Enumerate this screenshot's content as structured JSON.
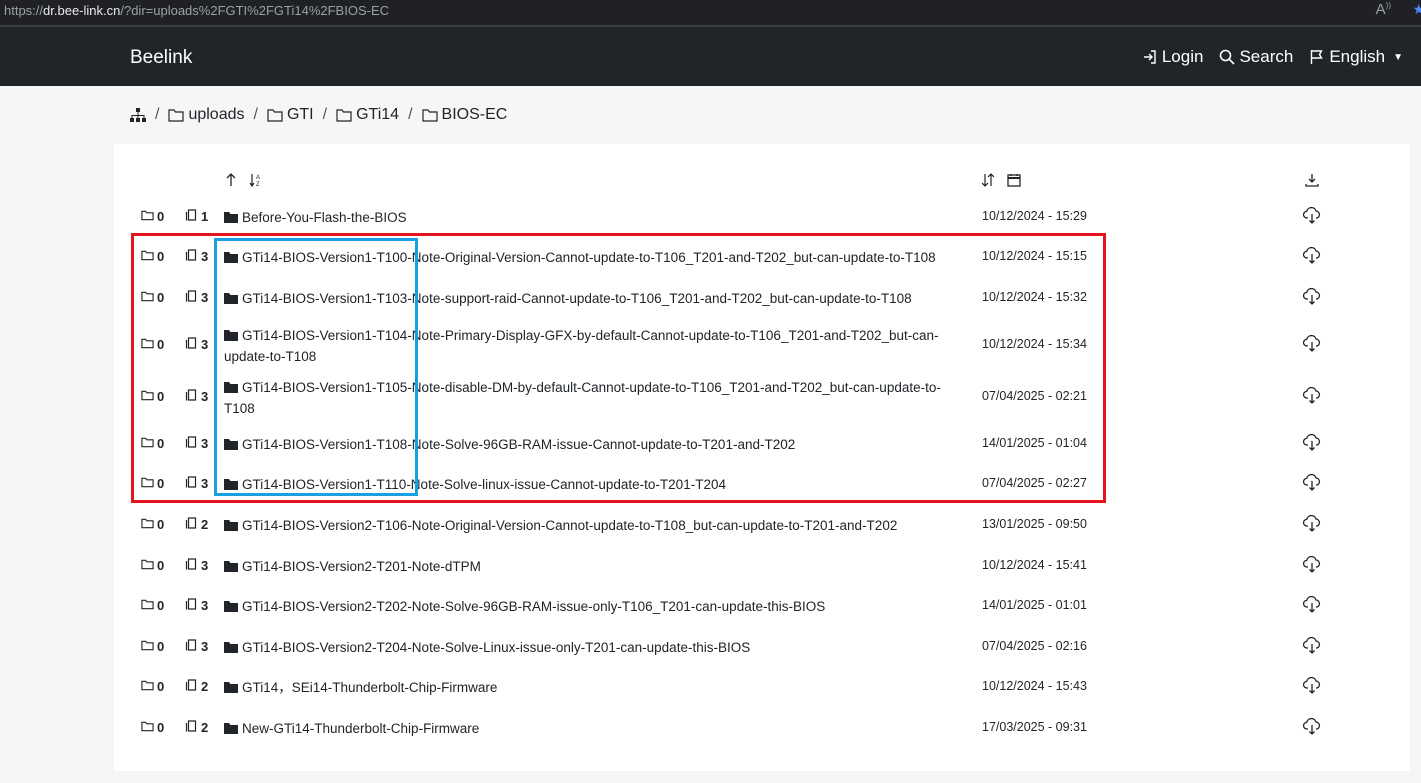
{
  "browser": {
    "url_scheme": "https://",
    "url_host": "dr.bee-link.cn",
    "url_query": "/?dir=uploads%2FGTI%2FGTi14%2FBIOS-EC",
    "read_aloud_icon": "read-aloud-icon",
    "favorite_icon": "star-icon"
  },
  "navbar": {
    "brand": "Beelink",
    "login": "Login",
    "search": "Search",
    "language": "English"
  },
  "breadcrumb": {
    "items": [
      "uploads",
      "GTI",
      "GTi14",
      "BIOS-EC"
    ],
    "separator": "/"
  },
  "colors": {
    "navbar": "#212529",
    "highlight_red": "#e5121f",
    "highlight_blue": "#1a9fe0"
  },
  "rows": [
    {
      "folders": "0",
      "files": "1",
      "name_line1": "Before-You-Flash-the-BIOS",
      "name_line2": "",
      "date": "10/12/2024 - 15:29"
    },
    {
      "folders": "0",
      "files": "3",
      "name_line1": "GTi14-BIOS-Version1-T100-Note-Original-Version-Cannot-update-to-T106_T201-and-T202_but-can-update-to-T108",
      "name_line2": "",
      "date": "10/12/2024 - 15:15"
    },
    {
      "folders": "0",
      "files": "3",
      "name_line1": "GTi14-BIOS-Version1-T103-Note-support-raid-Cannot-update-to-T106_T201-and-T202_but-can-update-to-T108",
      "name_line2": "",
      "date": "10/12/2024 - 15:32"
    },
    {
      "folders": "0",
      "files": "3",
      "name_line1": "GTi14-BIOS-Version1-T104-Note-Primary-Display-GFX-by-default-Cannot-update-to-T106_T201-and-T202_but-can-",
      "name_line2": "update-to-T108",
      "date": "10/12/2024 - 15:34"
    },
    {
      "folders": "0",
      "files": "3",
      "name_line1": "GTi14-BIOS-Version1-T105-Note-disable-DM-by-default-Cannot-update-to-T106_T201-and-T202_but-can-update-to-",
      "name_line2": "T108",
      "date": "07/04/2025 - 02:21"
    },
    {
      "folders": "0",
      "files": "3",
      "name_line1": "GTi14-BIOS-Version1-T108-Note-Solve-96GB-RAM-issue-Cannot-update-to-T201-and-T202",
      "name_line2": "",
      "date": "14/01/2025 - 01:04"
    },
    {
      "folders": "0",
      "files": "3",
      "name_line1": "GTi14-BIOS-Version1-T110-Note-Solve-linux-issue-Cannot-update-to-T201-T204",
      "name_line2": "",
      "date": "07/04/2025 - 02:27"
    },
    {
      "folders": "0",
      "files": "2",
      "name_line1": "GTi14-BIOS-Version2-T106-Note-Original-Version-Cannot-update-to-T108_but-can-update-to-T201-and-T202",
      "name_line2": "",
      "date": "13/01/2025 - 09:50"
    },
    {
      "folders": "0",
      "files": "3",
      "name_line1": "GTi14-BIOS-Version2-T201-Note-dTPM",
      "name_line2": "",
      "date": "10/12/2024 - 15:41"
    },
    {
      "folders": "0",
      "files": "3",
      "name_line1": "GTi14-BIOS-Version2-T202-Note-Solve-96GB-RAM-issue-only-T106_T201-can-update-this-BIOS",
      "name_line2": "",
      "date": "14/01/2025 - 01:01"
    },
    {
      "folders": "0",
      "files": "3",
      "name_line1": "GTi14-BIOS-Version2-T204-Note-Solve-Linux-issue-only-T201-can-update-this-BIOS",
      "name_line2": "",
      "date": "07/04/2025 - 02:16"
    },
    {
      "folders": "0",
      "files": "2",
      "name_line1": "GTi14，SEi14-Thunderbolt-Chip-Firmware",
      "name_line2": "",
      "date": "10/12/2024 - 15:43"
    },
    {
      "folders": "0",
      "files": "2",
      "name_line1": "New-GTi14-Thunderbolt-Chip-Firmware",
      "name_line2": "",
      "date": "17/03/2025 - 09:31"
    }
  ]
}
